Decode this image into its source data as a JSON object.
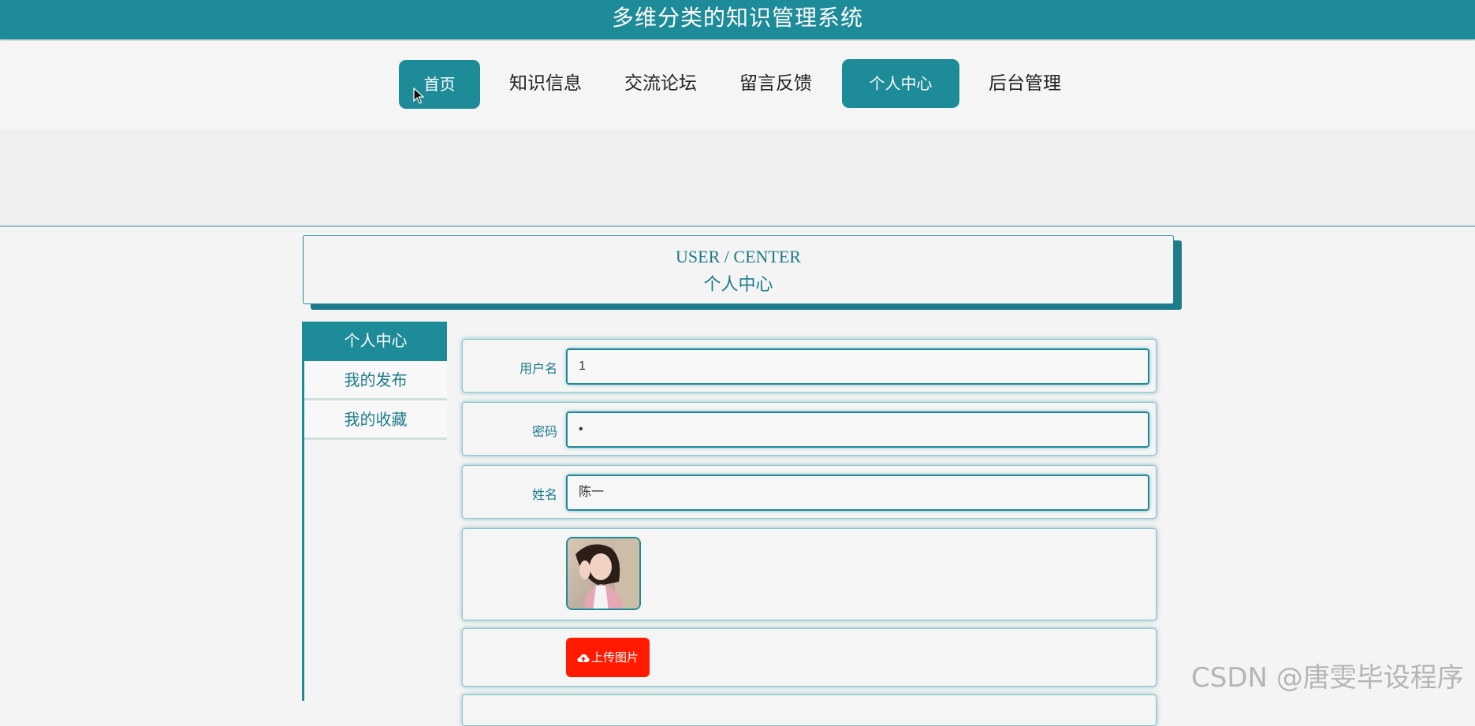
{
  "app": {
    "title": "多维分类的知识管理系统"
  },
  "nav": {
    "items": [
      {
        "label": "首页",
        "active": true
      },
      {
        "label": "知识信息",
        "active": false
      },
      {
        "label": "交流论坛",
        "active": false
      },
      {
        "label": "留言反馈",
        "active": false
      },
      {
        "label": "个人中心",
        "active": true
      },
      {
        "label": "后台管理",
        "active": false
      }
    ]
  },
  "header": {
    "en": "USER / CENTER",
    "cn": "个人中心"
  },
  "sidebar": {
    "items": [
      {
        "label": "个人中心",
        "active": true
      },
      {
        "label": "我的发布",
        "active": false
      },
      {
        "label": "我的收藏",
        "active": false
      }
    ]
  },
  "form": {
    "username": {
      "label": "用户名",
      "value": "1"
    },
    "password": {
      "label": "密码",
      "value": "•"
    },
    "name": {
      "label": "姓名",
      "value": "陈一"
    },
    "upload_label": "上传图片"
  },
  "watermark": "CSDN @唐雯毕设程序",
  "colors": {
    "primary": "#1e8b99",
    "upload": "#ff1a00"
  },
  "icons": {
    "cursor": "mouse-pointer-icon",
    "upload": "cloud-upload-icon"
  }
}
